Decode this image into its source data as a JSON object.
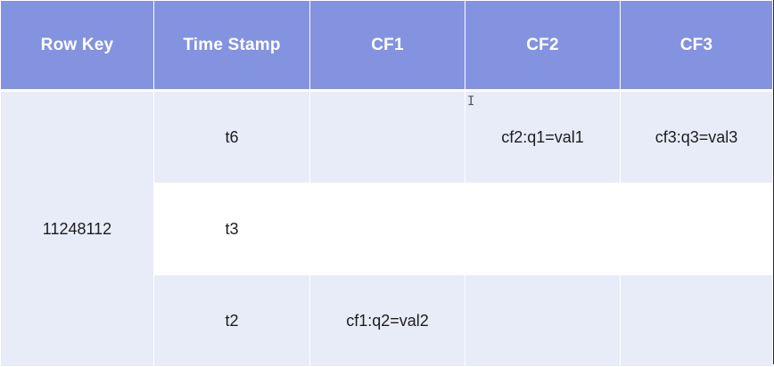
{
  "table": {
    "headers": [
      "Row Key",
      "Time Stamp",
      "CF1",
      "CF2",
      "CF3"
    ],
    "row_key": "11248112",
    "rows": [
      {
        "timestamp": "t6",
        "cf1": "",
        "cf2": "cf2:q1=val1",
        "cf3": "cf3:q3=val3"
      },
      {
        "timestamp": "t3",
        "cf1": "",
        "cf2": "",
        "cf3": ""
      },
      {
        "timestamp": "t2",
        "cf1": "cf1:q2=val2",
        "cf2": "",
        "cf3": ""
      }
    ]
  },
  "colors": {
    "header_bg": "#8493df",
    "row_tint": "#e8ebf8",
    "row_plain": "#ffffff",
    "header_text": "#ffffff"
  },
  "icons": {
    "cursor": "text-cursor-icon"
  }
}
